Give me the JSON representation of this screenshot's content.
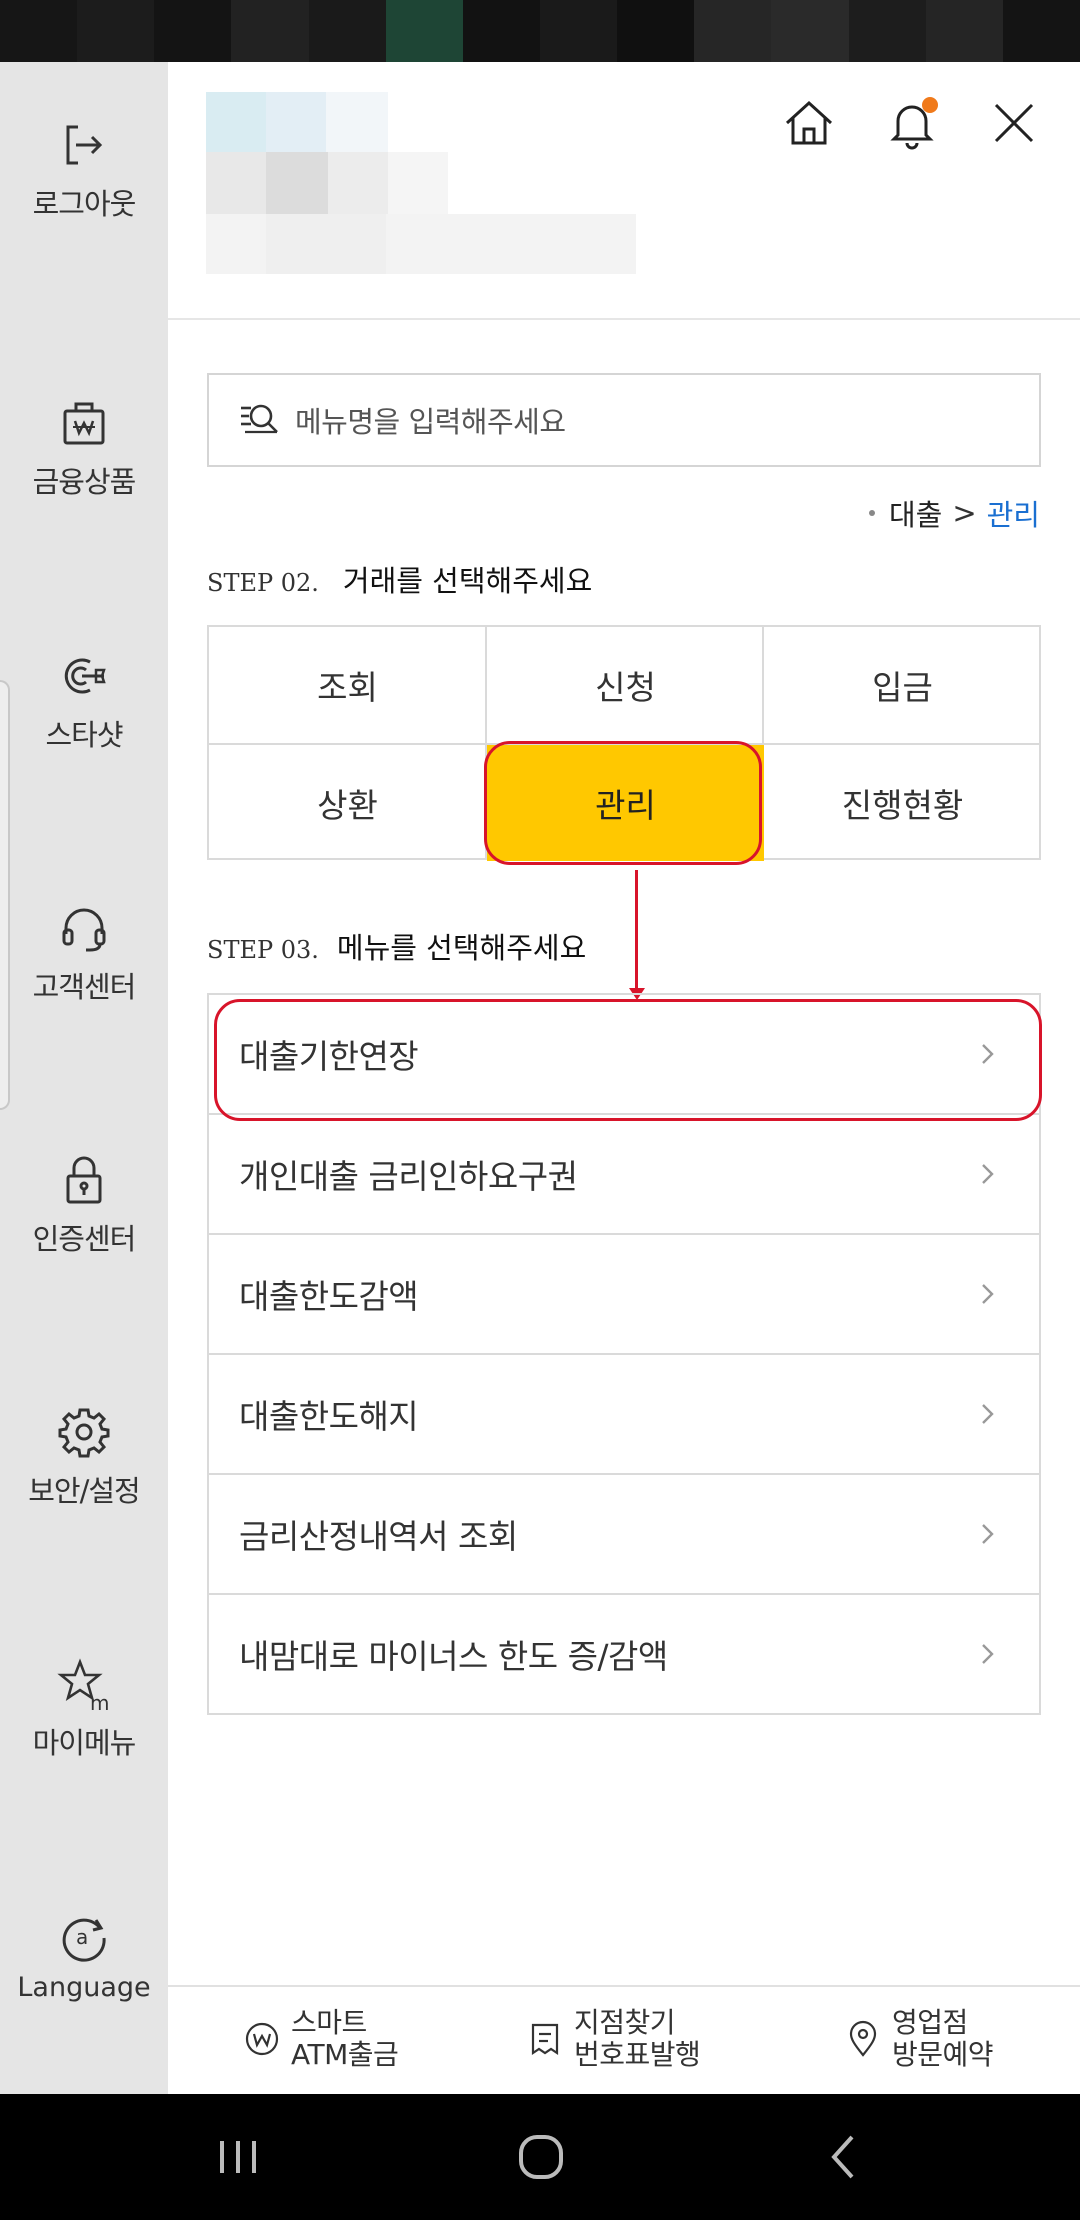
{
  "sidebar": {
    "items": [
      {
        "label": "로그아웃",
        "icon": "logout-icon"
      },
      {
        "label": "금융상품",
        "icon": "bag-icon"
      },
      {
        "label": "스타샷",
        "icon": "starshot-icon"
      },
      {
        "label": "고객센터",
        "icon": "headset-icon"
      },
      {
        "label": "인증센터",
        "icon": "lock-icon"
      },
      {
        "label": "보안/설정",
        "icon": "gear-icon"
      },
      {
        "label": "마이메뉴",
        "icon": "star-m-icon"
      },
      {
        "label": "Language",
        "icon": "language-icon"
      }
    ]
  },
  "header": {
    "icons": [
      "home-icon",
      "bell-icon",
      "close-icon"
    ],
    "notification_color": "#f07a1b"
  },
  "search": {
    "placeholder": "메뉴명을 입력해주세요"
  },
  "breadcrumb": {
    "parent": "대출",
    "separator": ">",
    "current": "관리"
  },
  "step2": {
    "step": "STEP 02.",
    "title": "거래를 선택해주세요",
    "options": [
      "조회",
      "신청",
      "입금",
      "상환",
      "관리",
      "진행현황"
    ],
    "selected": "관리"
  },
  "step3": {
    "step": "STEP 03.",
    "title": "메뉴를 선택해주세요",
    "items": [
      "대출기한연장",
      "개인대출 금리인하요구권",
      "대출한도감액",
      "대출한도해지",
      "금리산정내역서 조회",
      "내맘대로 마이너스 한도 증/감액"
    ]
  },
  "bottom_bar": {
    "items": [
      {
        "line1": "스마트",
        "line2": "ATM출금",
        "icon": "atm-w-icon"
      },
      {
        "line1": "지점찾기",
        "line2": "번호표발행",
        "icon": "ticket-icon"
      },
      {
        "line1": "영업점",
        "line2": "방문예약",
        "icon": "location-pin-icon"
      }
    ]
  },
  "colors": {
    "accent_yellow": "#ffc800",
    "highlight_red": "#d8142a",
    "link_blue": "#1a6fd1",
    "sidebar_bg": "#e5e5e5"
  }
}
